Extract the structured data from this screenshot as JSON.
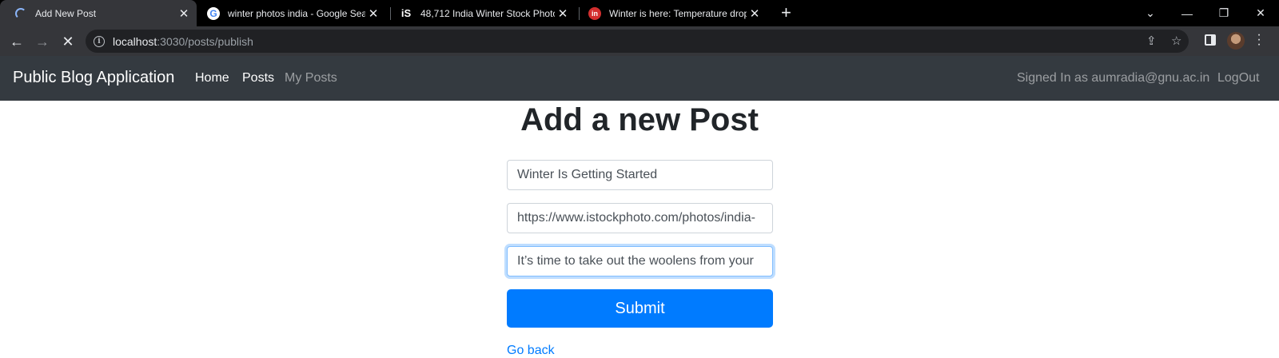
{
  "browser": {
    "tabs": [
      {
        "title": "Add New Post",
        "favicon": "loading-spinner-icon",
        "active": true
      },
      {
        "title": "winter photos india - Google Sea",
        "favicon": "google-icon",
        "active": false
      },
      {
        "title": "48,712 India Winter Stock Photos",
        "favicon": "istock-icon",
        "active": false
      },
      {
        "title": "Winter is here: Temperature drop",
        "favicon": "inshorts-icon",
        "active": false
      }
    ],
    "new_tab_glyph": "+",
    "window_controls": {
      "list": "⌄",
      "minimize": "—",
      "restore": "❐",
      "close": "✕"
    },
    "url_host": "localhost",
    "url_rest": ":3030/posts/publish",
    "accent": "#8ab4f8"
  },
  "navbar": {
    "brand": "Public Blog Application",
    "links": [
      "Home",
      "Posts",
      "My Posts"
    ],
    "signed_in_text": "Signed In as aumradia@gnu.ac.in",
    "logout": "LogOut",
    "background": "#343a40"
  },
  "form": {
    "heading": "Add a new Post",
    "title_value": "Winter Is Getting Started",
    "image_url_value": "https://www.istockphoto.com/photos/india-",
    "content_value": "It’s time to take out the woolens from your",
    "submit_label": "Submit",
    "go_back": "Go back",
    "primary_color": "#007bff"
  }
}
